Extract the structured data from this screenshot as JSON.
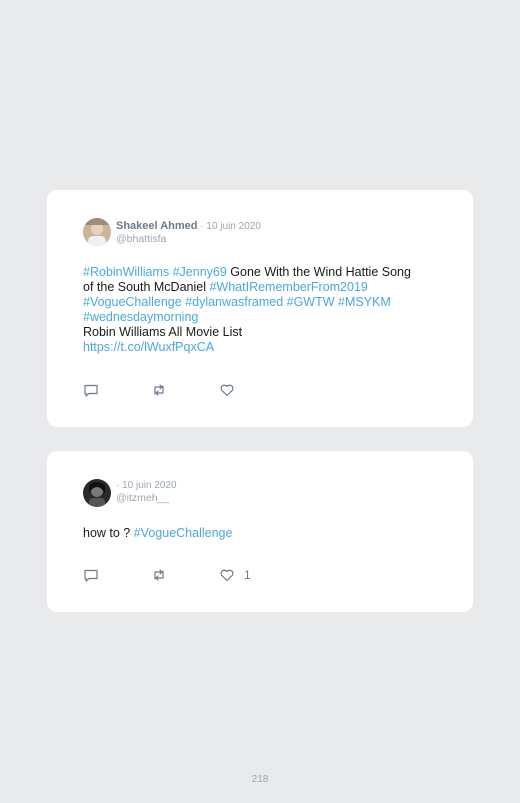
{
  "tweets": [
    {
      "author_name": "Shakeel Ahmed",
      "date": " · 10 juin 2020",
      "handle": "@bhattisfa",
      "text": {
        "l1_tags": "#RobinWilliams #Jenny69",
        "l1_plain": " Gone With the Wind Hattie Song",
        "l2_plain": "of the South McDaniel ",
        "l2_tag": "#WhatIRememberFrom2019",
        "l3_tags": "#VogueChallenge #dylanwasframed #GWTW #MSYKM",
        "l4_tags": "#wednesdaymorning",
        "l5_plain": "Robin Williams All Movie List",
        "l6_link": "https://t.co/lWuxfPqxCA"
      },
      "likes": ""
    },
    {
      "author_name": "",
      "date": "· 10 juin 2020",
      "handle": "@itzmeh__",
      "text": {
        "plain": "how to ? ",
        "tag": "#VogueChallenge"
      },
      "likes": "1"
    }
  ],
  "icons": [
    "reply-icon",
    "retweet-icon",
    "like-icon"
  ],
  "colors": {
    "accent": "#4aa8e0",
    "muted": "#9aa5b1",
    "name": "#6b7a8c",
    "background": "#e9eaec"
  },
  "page_number": "218"
}
